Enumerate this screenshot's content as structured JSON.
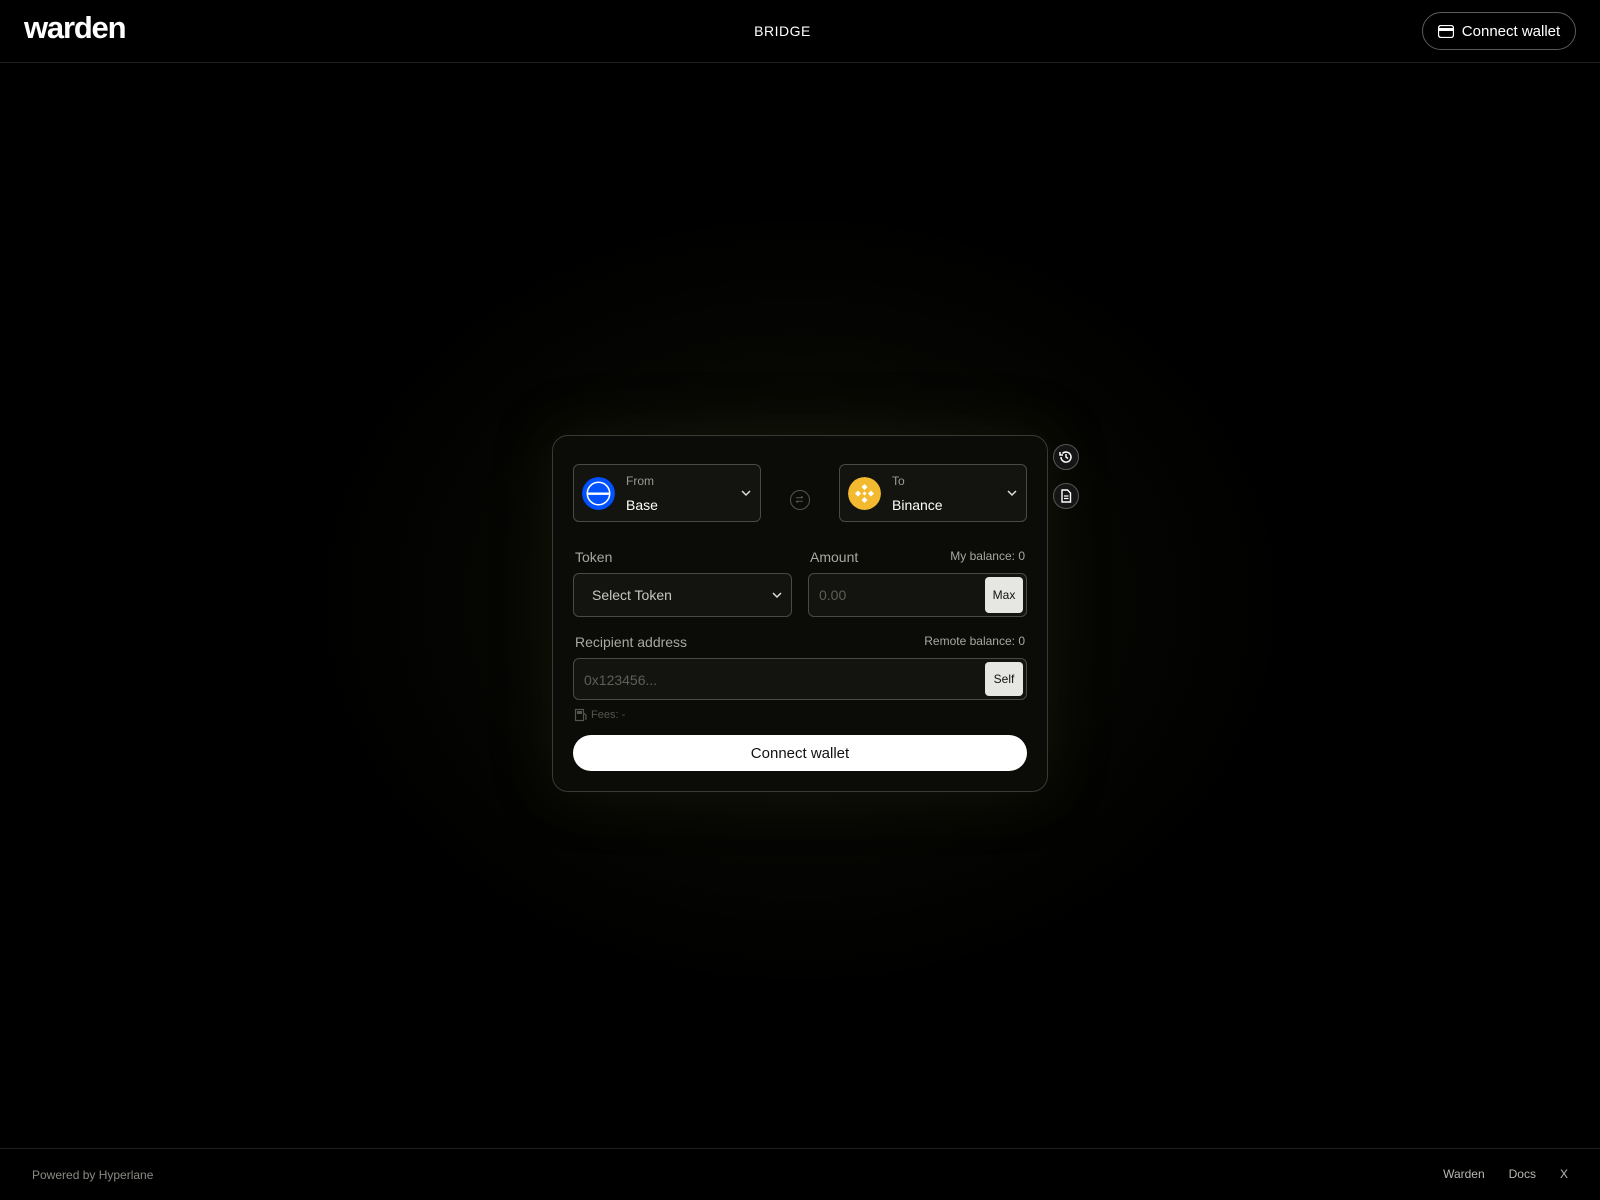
{
  "header": {
    "logo": "warden",
    "nav_title": "BRIDGE",
    "connect_label": "Connect wallet"
  },
  "bridge": {
    "from": {
      "caption": "From",
      "chain": "Base",
      "icon": "base-logo",
      "color": "#0052ff"
    },
    "to": {
      "caption": "To",
      "chain": "Binance",
      "icon": "binance-logo",
      "color": "#f3ba2f"
    },
    "token": {
      "label": "Token",
      "placeholder": "Select Token"
    },
    "amount": {
      "label": "Amount",
      "balance": "My balance: 0",
      "placeholder": "0.00",
      "max_label": "Max"
    },
    "recipient": {
      "label": "Recipient address",
      "remote_balance": "Remote balance: 0",
      "placeholder": "0x123456...",
      "self_label": "Self"
    },
    "fees": "Fees: -",
    "connect_label": "Connect wallet"
  },
  "side_actions": [
    {
      "icon": "history-icon"
    },
    {
      "icon": "document-icon"
    }
  ],
  "footer": {
    "powered_by": "Powered by Hyperlane",
    "links": [
      "Warden",
      "Docs",
      "X"
    ]
  }
}
